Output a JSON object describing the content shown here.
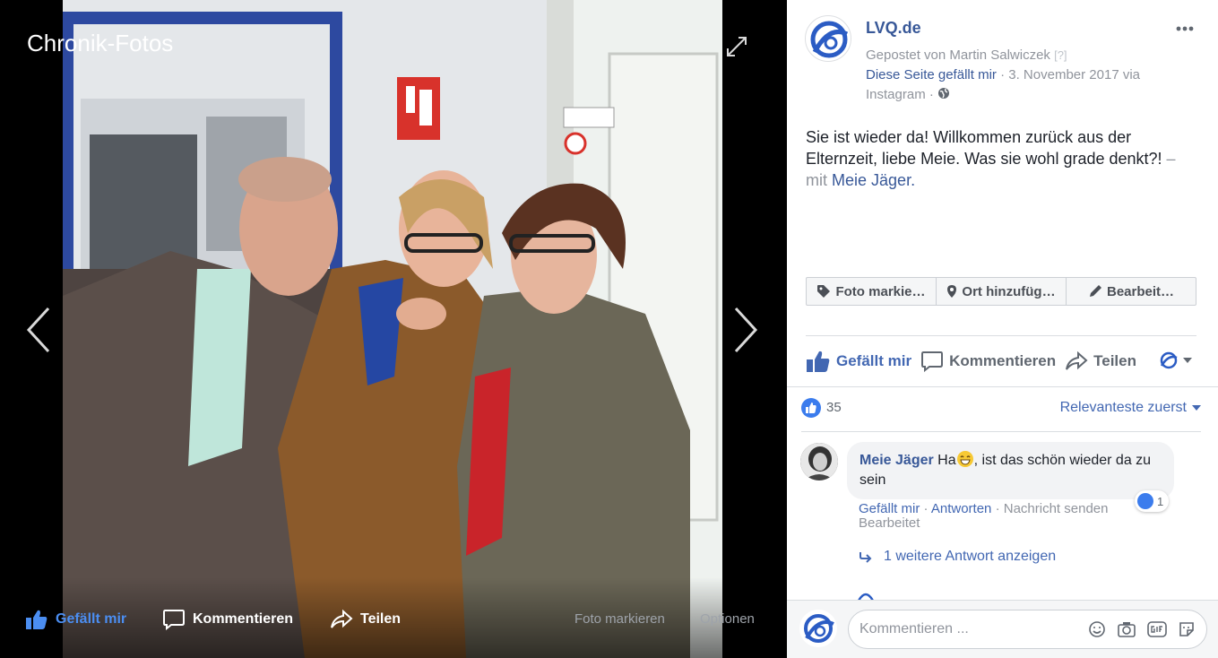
{
  "viewer": {
    "title": "Chronik-Fotos",
    "actions": {
      "like": "Gefällt mir",
      "comment": "Kommentieren",
      "share": "Teilen",
      "tag_photo": "Foto markieren",
      "options": "Optionen"
    }
  },
  "post": {
    "page_name": "LVQ.de",
    "posted_by": "Gepostet von Martin Salwiczek",
    "help_mark": "[?]",
    "page_like_link": "Diese Seite gefällt mir",
    "sep": "·",
    "date_source": "3. November 2017 via",
    "source": "Instagram",
    "text": "Sie ist wieder da! Willkommen zurück aus der Elternzeit, liebe Meie. Was sie wohl grade denkt?!",
    "with_prefix": "– mit",
    "tagged_person": "Meie Jäger",
    "tagged_suffix": "."
  },
  "tag_buttons": {
    "tag": "Foto markie…",
    "location": "Ort hinzufüg…",
    "edit": "Bearbeit…"
  },
  "actions": {
    "like": "Gefällt mir",
    "comment": "Kommentieren",
    "share": "Teilen"
  },
  "reactions": {
    "count": "35",
    "sort": "Relevanteste zuerst"
  },
  "comment": {
    "author": "Meie Jäger",
    "text_before_emoji": "Ha",
    "text_after_emoji": ", ist das schön wieder da zu sein",
    "reaction_count": "1",
    "links": {
      "like": "Gefällt mir",
      "reply": "Antworten",
      "message": "Nachricht senden",
      "time": "",
      "edited": "Bearbeitet"
    },
    "more_replies": "1 weitere Antwort anzeigen"
  },
  "composer": {
    "placeholder": "Kommentieren ..."
  },
  "colors": {
    "facebook_blue": "#4267b2",
    "link_blue": "#385898",
    "like_blue": "#3b7ced",
    "viewer_like_blue": "#4b8ef2"
  }
}
